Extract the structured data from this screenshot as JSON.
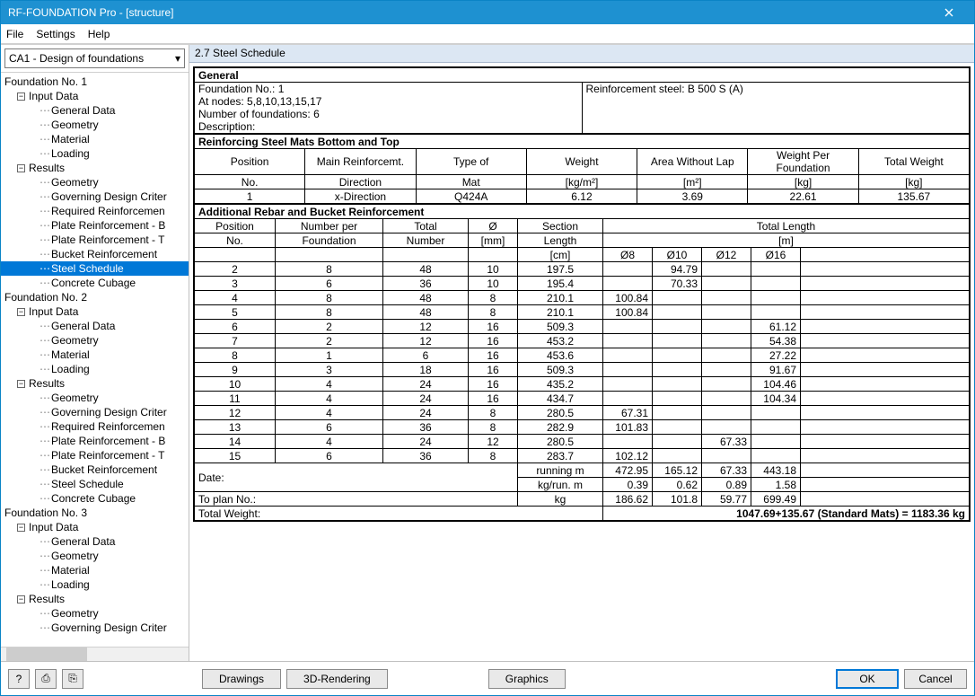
{
  "window": {
    "title": "RF-FOUNDATION Pro - [structure]"
  },
  "menu": {
    "file": "File",
    "settings": "Settings",
    "help": "Help"
  },
  "left": {
    "combo": "CA1 - Design of foundations",
    "tree": {
      "f1": "Foundation No. 1",
      "f2": "Foundation No. 2",
      "f3": "Foundation No. 3",
      "input": "Input Data",
      "results": "Results",
      "gen": "General Data",
      "geo": "Geometry",
      "mat": "Material",
      "load": "Loading",
      "gov": "Governing Design Criter",
      "req": "Required Reinforcemen",
      "pb": "Plate Reinforcement - B",
      "pt": "Plate Reinforcement - T",
      "buck": "Bucket Reinforcement",
      "steel": "Steel Schedule",
      "cub": "Concrete Cubage"
    }
  },
  "pane": {
    "title": "2.7 Steel Schedule"
  },
  "general": {
    "label": "General",
    "fno": "Foundation No.: 1",
    "nodes": "At nodes: 5,8,10,13,15,17",
    "nfound": "Number of foundations: 6",
    "desc": "Description:",
    "reinf": "Reinforcement steel: B 500 S (A)"
  },
  "mats": {
    "title": "Reinforcing Steel Mats Bottom and Top",
    "h_pos": "Position",
    "h_no": "No.",
    "h_dir": "Main Reinforcemt.",
    "h_dir2": "Direction",
    "h_type": "Type of",
    "h_mat": "Mat",
    "h_w": "Weight",
    "h_w2": "[kg/m²]",
    "h_a": "Area Without Lap",
    "h_a2": "[m²]",
    "h_wpf": "Weight Per Foundation",
    "h_wpf2": "[kg]",
    "h_tw": "Total Weight",
    "h_tw2": "[kg]",
    "row": {
      "pos": "1",
      "dir": "x-Direction",
      "type": "Q424A",
      "w": "6.12",
      "a": "3.69",
      "wpf": "22.61",
      "tw": "135.67"
    }
  },
  "rebar": {
    "title": "Additional Rebar and Bucket Reinforcement",
    "h_pos": "Position",
    "h_no": "No.",
    "h_npf": "Number per",
    "h_npf2": "Foundation",
    "h_tn": "Total",
    "h_tn2": "Number",
    "h_d": "Ø",
    "h_d2": "[mm]",
    "h_sl": "Section",
    "h_sl2": "Length",
    "h_sl3": "[cm]",
    "h_tl": "Total Length",
    "h_tl2": "[m]",
    "d8": "Ø8",
    "d10": "Ø10",
    "d12": "Ø12",
    "d16": "Ø16",
    "rows": [
      {
        "pos": "2",
        "npf": "8",
        "tn": "48",
        "d": "10",
        "sl": "197.5",
        "l8": "",
        "l10": "94.79",
        "l12": "",
        "l16": ""
      },
      {
        "pos": "3",
        "npf": "6",
        "tn": "36",
        "d": "10",
        "sl": "195.4",
        "l8": "",
        "l10": "70.33",
        "l12": "",
        "l16": ""
      },
      {
        "pos": "4",
        "npf": "8",
        "tn": "48",
        "d": "8",
        "sl": "210.1",
        "l8": "100.84",
        "l10": "",
        "l12": "",
        "l16": ""
      },
      {
        "pos": "5",
        "npf": "8",
        "tn": "48",
        "d": "8",
        "sl": "210.1",
        "l8": "100.84",
        "l10": "",
        "l12": "",
        "l16": ""
      },
      {
        "pos": "6",
        "npf": "2",
        "tn": "12",
        "d": "16",
        "sl": "509.3",
        "l8": "",
        "l10": "",
        "l12": "",
        "l16": "61.12"
      },
      {
        "pos": "7",
        "npf": "2",
        "tn": "12",
        "d": "16",
        "sl": "453.2",
        "l8": "",
        "l10": "",
        "l12": "",
        "l16": "54.38"
      },
      {
        "pos": "8",
        "npf": "1",
        "tn": "6",
        "d": "16",
        "sl": "453.6",
        "l8": "",
        "l10": "",
        "l12": "",
        "l16": "27.22"
      },
      {
        "pos": "9",
        "npf": "3",
        "tn": "18",
        "d": "16",
        "sl": "509.3",
        "l8": "",
        "l10": "",
        "l12": "",
        "l16": "91.67"
      },
      {
        "pos": "10",
        "npf": "4",
        "tn": "24",
        "d": "16",
        "sl": "435.2",
        "l8": "",
        "l10": "",
        "l12": "",
        "l16": "104.46"
      },
      {
        "pos": "11",
        "npf": "4",
        "tn": "24",
        "d": "16",
        "sl": "434.7",
        "l8": "",
        "l10": "",
        "l12": "",
        "l16": "104.34"
      },
      {
        "pos": "12",
        "npf": "4",
        "tn": "24",
        "d": "8",
        "sl": "280.5",
        "l8": "67.31",
        "l10": "",
        "l12": "",
        "l16": ""
      },
      {
        "pos": "13",
        "npf": "6",
        "tn": "36",
        "d": "8",
        "sl": "282.9",
        "l8": "101.83",
        "l10": "",
        "l12": "",
        "l16": ""
      },
      {
        "pos": "14",
        "npf": "4",
        "tn": "24",
        "d": "12",
        "sl": "280.5",
        "l8": "",
        "l10": "",
        "l12": "67.33",
        "l16": ""
      },
      {
        "pos": "15",
        "npf": "6",
        "tn": "36",
        "d": "8",
        "sl": "283.7",
        "l8": "102.12",
        "l10": "",
        "l12": "",
        "l16": ""
      }
    ]
  },
  "totals": {
    "date": "Date:",
    "plan": "To plan No.:",
    "runm": "running m",
    "v_runm": [
      "472.95",
      "165.12",
      "67.33",
      "443.18"
    ],
    "kgrun": "kg/run. m",
    "v_kgrun": [
      "0.39",
      "0.62",
      "0.89",
      "1.58"
    ],
    "kg": "kg",
    "v_kg": [
      "186.62",
      "101.8",
      "59.77",
      "699.49"
    ],
    "tw": "Total Weight:",
    "tw_val": "1047.69+135.67 (Standard Mats) = 1183.36 kg"
  },
  "footer": {
    "drawings": "Drawings",
    "render": "3D-Rendering",
    "graphics": "Graphics",
    "ok": "OK",
    "cancel": "Cancel"
  }
}
